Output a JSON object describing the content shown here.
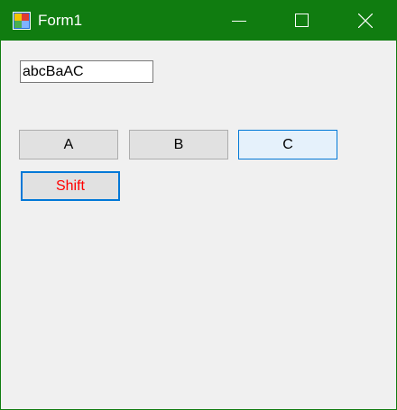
{
  "window": {
    "title": "Form1",
    "colors": {
      "titlebar": "#107c10",
      "background": "#f0f0f0"
    },
    "icons": {
      "app": "winforms-app-icon",
      "minimize": "minimize-icon",
      "maximize": "maximize-icon",
      "close": "close-icon"
    }
  },
  "textbox": {
    "value": "abcBaAC"
  },
  "buttons": {
    "a": {
      "label": "A"
    },
    "b": {
      "label": "B"
    },
    "c": {
      "label": "C"
    },
    "shift": {
      "label": "Shift",
      "color": "#ff0000"
    }
  }
}
